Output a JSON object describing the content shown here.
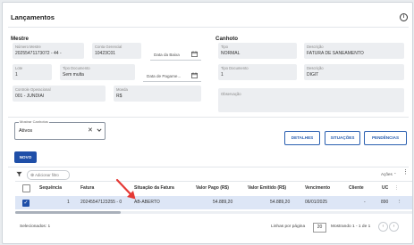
{
  "header": {
    "title": "Lançamentos",
    "info_icon": "info-icon"
  },
  "mestre": {
    "title": "Mestre",
    "numero_mestre": {
      "label": "Número Mestre",
      "value": "20255471173072 - 44 -"
    },
    "conta_gerencial": {
      "label": "Conta Gerencial",
      "value": "10423C01"
    },
    "data_baixa": {
      "label": "Data da Baixa"
    },
    "lote": {
      "label": "Lote",
      "value": "1"
    },
    "tipo_documento": {
      "label": "Tipo Documento",
      "value": "Sem multa"
    },
    "data_pagamento": {
      "label": "Data de Pagame..."
    },
    "controle_operacional": {
      "label": "Controle Operacional",
      "value": "001 - JUNDIAI"
    },
    "moeda": {
      "label": "Moeda",
      "value": "R$"
    }
  },
  "canhoto": {
    "title": "Canhoto",
    "tipo": {
      "label": "Tipo",
      "value": "NORMAL"
    },
    "descricao1": {
      "label": "Descrição",
      "value": "FATURA DE SANEAMENTO"
    },
    "tipo_documento": {
      "label": "Tipo Documento",
      "value": "1"
    },
    "descricao2": {
      "label": "Descrição",
      "value": "DIGIT"
    },
    "observacao": {
      "label": "Observação"
    }
  },
  "filter": {
    "label": "Mostrar Canhotos",
    "value": "Ativos",
    "clear": "✕"
  },
  "buttons": {
    "detalhes": "DETALHES",
    "situacoes": "SITUAÇÕES",
    "pendencias": "PENDÊNCIAS",
    "novo": "NOVO"
  },
  "toolbar": {
    "add_filter": "Adicionar filtro",
    "acoes": "Ações"
  },
  "table": {
    "headers": [
      "Sequência",
      "Fatura",
      "Situação da Fatura",
      "Valor Pago (R$)",
      "Valor Emitido (R$)",
      "Vencimento",
      "Cliente",
      "UC"
    ],
    "row": {
      "sequencia": "1",
      "fatura": "20245547123255 - 0",
      "situacao": "AB-ABERTO",
      "valor_pago": "54.889,20",
      "valor_emitido": "54.889,20",
      "vencimento": "06/01/2025",
      "cliente": "-",
      "uc": "890"
    }
  },
  "footer": {
    "selecionados": "Selecionados: 1",
    "linhas_label": "Linhas por página",
    "linhas_value": "20",
    "range": "Mostrando 1 - 1 de 1"
  },
  "colors": {
    "accent": "#1f4fa8",
    "selected_row": "#dde6f6",
    "annotation_arrow": "#e53935"
  }
}
